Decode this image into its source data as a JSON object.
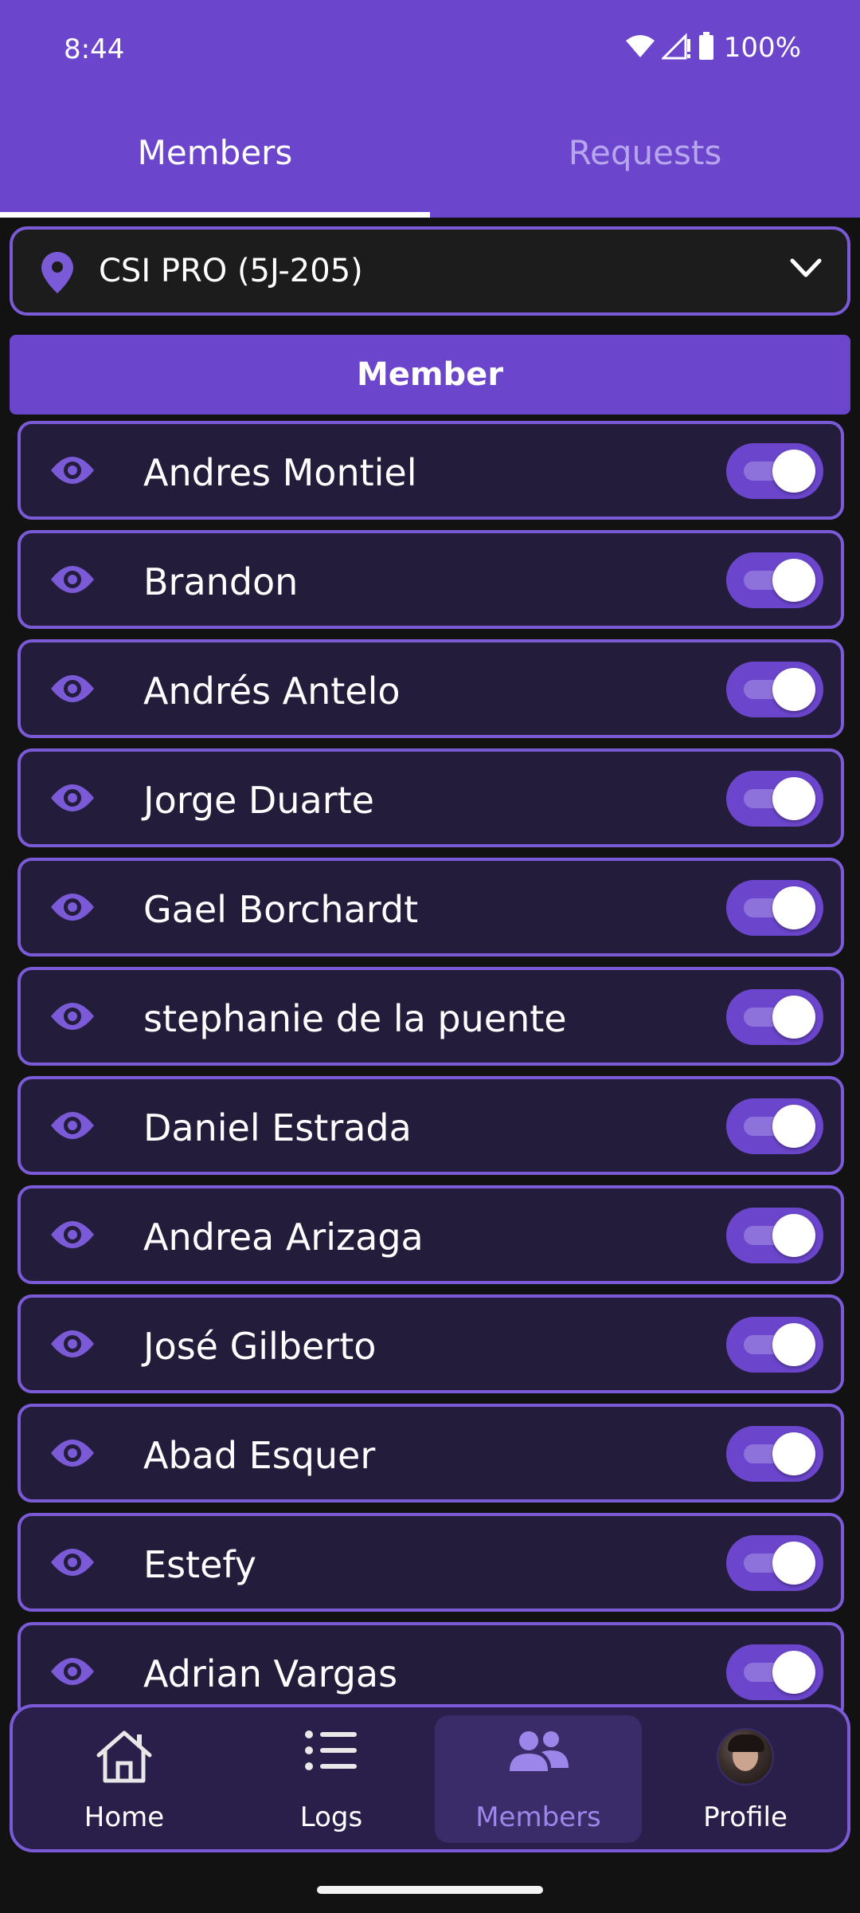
{
  "status_bar": {
    "time": "8:44",
    "battery": "100%"
  },
  "tabs": [
    {
      "label": "Members",
      "active": true
    },
    {
      "label": "Requests",
      "active": false
    }
  ],
  "location": {
    "value": "CSI PRO (5J-205)",
    "icon": "location-pin-icon"
  },
  "section_header": "Member",
  "members": [
    {
      "name": "Andres Montiel",
      "enabled": true
    },
    {
      "name": "Brandon",
      "enabled": true
    },
    {
      "name": "Andrés Antelo",
      "enabled": true
    },
    {
      "name": "Jorge Duarte",
      "enabled": true
    },
    {
      "name": "Gael Borchardt",
      "enabled": true
    },
    {
      "name": "stephanie de la puente",
      "enabled": true
    },
    {
      "name": "Daniel Estrada",
      "enabled": true
    },
    {
      "name": "Andrea Arizaga",
      "enabled": true
    },
    {
      "name": "José Gilberto",
      "enabled": true
    },
    {
      "name": "Abad Esquer",
      "enabled": true
    },
    {
      "name": "Estefy",
      "enabled": true
    },
    {
      "name": "Adrian Vargas",
      "enabled": true
    }
  ],
  "bottom_nav": [
    {
      "label": "Home",
      "icon": "home-icon",
      "active": false
    },
    {
      "label": "Logs",
      "icon": "list-icon",
      "active": false
    },
    {
      "label": "Members",
      "icon": "group-icon",
      "active": true
    },
    {
      "label": "Profile",
      "icon": "avatar",
      "active": false
    }
  ],
  "colors": {
    "primary": "#6b46cc",
    "row_background": "#231c3b",
    "border": "#7a5ad6",
    "background": "#121212"
  }
}
